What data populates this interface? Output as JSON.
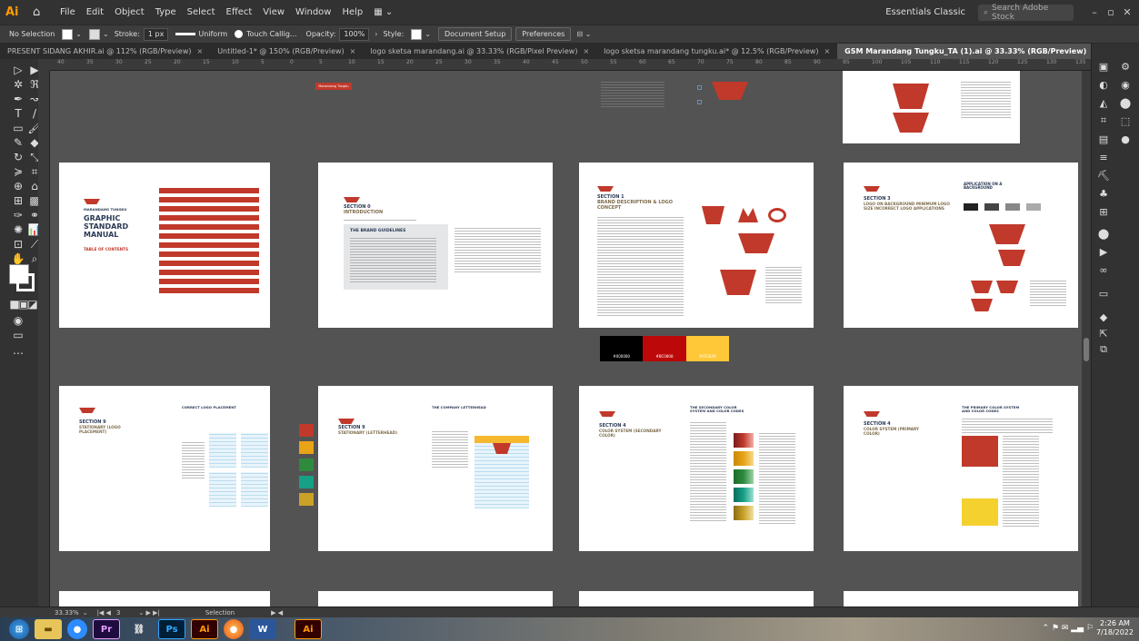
{
  "menubar": {
    "logo": "Ai",
    "items": [
      "File",
      "Edit",
      "Object",
      "Type",
      "Select",
      "Effect",
      "View",
      "Window",
      "Help"
    ],
    "workspace": "Essentials Classic",
    "search_placeholder": "Search Adobe Stock"
  },
  "control": {
    "selection": "No Selection",
    "stroke_label": "Stroke:",
    "stroke_value": "1 px",
    "uniform": "Uniform",
    "brush": "Touch Callig...",
    "opacity_label": "Opacity:",
    "opacity_value": "100%",
    "style_label": "Style:",
    "doc_setup": "Document Setup",
    "preferences": "Preferences"
  },
  "tabs": [
    {
      "label": "PRESENT SIDANG AKHIR.ai @ 112% (RGB/Preview)",
      "active": false
    },
    {
      "label": "Untitled-1* @ 150% (RGB/Preview)",
      "active": false
    },
    {
      "label": "logo sketsa marandang.ai @ 33.33% (RGB/Pixel Preview)",
      "active": false
    },
    {
      "label": "logo sketsa marandang tungku.ai* @ 12.5% (RGB/Preview)",
      "active": false
    },
    {
      "label": "GSM Marandang Tungku_TA (1).ai @ 33.33% (RGB/Preview)",
      "active": true
    }
  ],
  "ruler": [
    "40",
    "35",
    "30",
    "25",
    "20",
    "15",
    "10",
    "5",
    "0",
    "5",
    "10",
    "15",
    "20",
    "25",
    "30",
    "35",
    "40",
    "45",
    "50",
    "55",
    "60",
    "65",
    "70",
    "75",
    "80",
    "85",
    "90",
    "95",
    "100",
    "105",
    "110",
    "115",
    "120",
    "125",
    "130",
    "135"
  ],
  "status": {
    "zoom": "33.33%",
    "artboard": "3",
    "tool": "Selection"
  },
  "colors": {
    "brand_red": "#C0392B",
    "brand_gold": "#F5B82E",
    "navy": "#2B3A55"
  },
  "artboards": {
    "toc": {
      "brand": "MARANDANG TUNGKU",
      "title": "GRAPHIC STANDARD MANUAL",
      "toc_label": "TABLE OF CONTENTS"
    },
    "intro": {
      "section": "SECTION 0",
      "title": "INTRODUCTION",
      "box_title": "THE BRAND GUIDELINES"
    },
    "brand_desc": {
      "section": "SECTION 1",
      "title": "BRAND DESCRIPTION & LOGO CONCEPT"
    },
    "logo_bg": {
      "section": "SECTION 3",
      "title": "LOGO ON BACKGROUND MINIMUM LOGO SIZE INCORRECT LOGO APPLICATIONS",
      "header": "APPLICATION ON A BACKGROUND"
    },
    "stationary_logo": {
      "section": "SECTION 9",
      "title": "STATIONARY (LOGO PLACEMENT)",
      "header": "CORRECT LOGO PLACEMENT"
    },
    "stationary_letter": {
      "section": "SECTION 9",
      "title": "STATIONARY (LETTERHEAD)",
      "header": "THE COMPANY LETTERHEAD"
    },
    "secondary_color": {
      "section": "SECTION 4",
      "title": "COLOR SYSTEM (SECONDARY COLOR)",
      "header": "THE SECONDARY COLOR SYSTEM AND COLOR CODES"
    },
    "primary_color": {
      "section": "SECTION 4",
      "title": "COLOR SYSTEM (PRIMARY COLOR)",
      "header": "THE PRIMARY COLOR SYSTEM AND COLOR CODES"
    }
  },
  "color_strip": [
    "#000000",
    "#BC0808",
    "#FFC839"
  ],
  "color_strip_labels": [
    "#000000",
    "#BC0808",
    "#FFC839"
  ],
  "side_swatches": [
    "#C0392B",
    "#E8A317",
    "#2E8B3E",
    "#16A085",
    "#C9A227"
  ],
  "red_badge": "Marandang Tungku",
  "taskbar": {
    "time": "2:26 AM",
    "date": "7/18/2022"
  }
}
